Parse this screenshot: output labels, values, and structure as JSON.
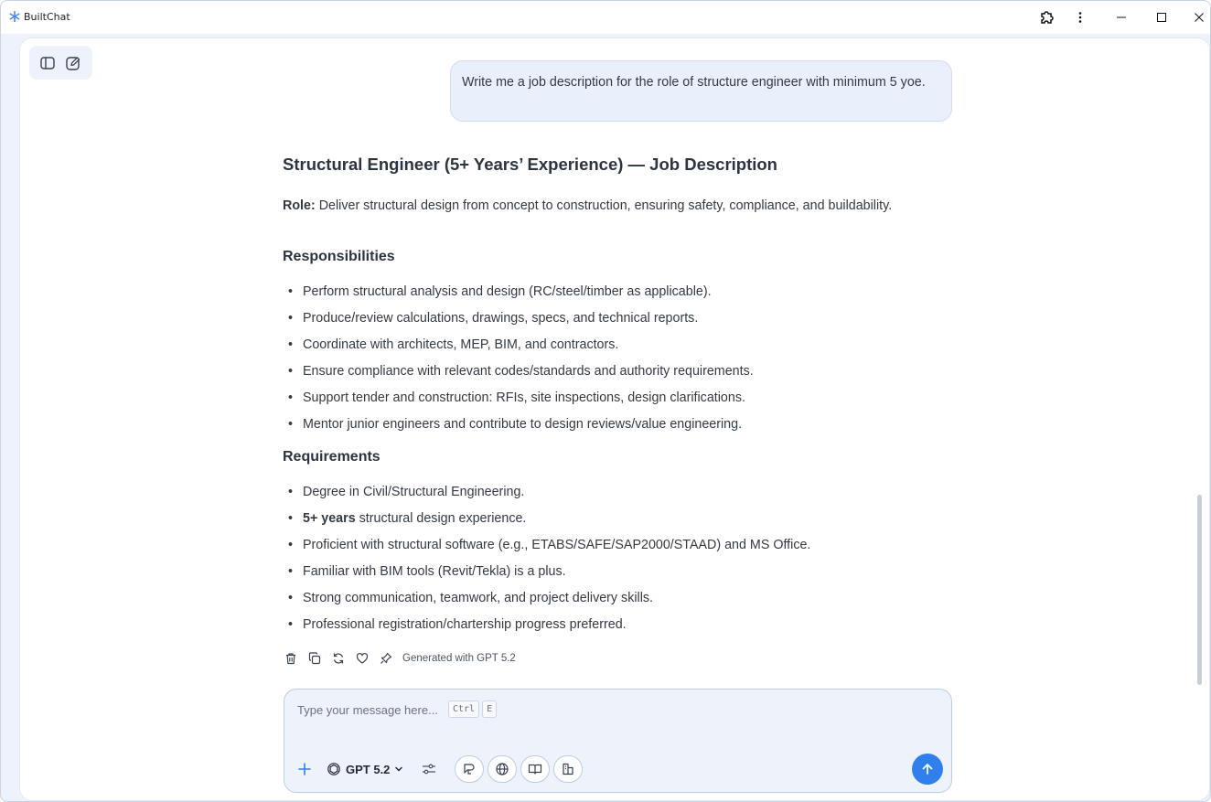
{
  "window": {
    "title": "BuiltChat"
  },
  "titlebar": {
    "icons": [
      "extension-icon",
      "more-vertical-icon",
      "minimize-icon",
      "maximize-icon",
      "close-icon"
    ]
  },
  "toolbar": {
    "icons": [
      "sidebar-toggle-icon",
      "new-chat-icon"
    ]
  },
  "conversation": {
    "user_message": "Write me a job description for the role of structure engineer with minimum 5 yoe.",
    "response": {
      "title": "Structural Engineer (5+ Years’ Experience) — Job Description",
      "role_label": "Role:",
      "role_text": " Deliver structural design from concept to construction, ensuring safety, compliance, and buildability.",
      "responsibilities_heading": "Responsibilities",
      "responsibilities": [
        "Perform structural analysis and design (RC/steel/timber as applicable).",
        "Produce/review calculations, drawings, specs, and technical reports.",
        "Coordinate with architects, MEP, BIM, and contractors.",
        "Ensure compliance with relevant codes/standards and authority requirements.",
        "Support tender and construction: RFIs, site inspections, design clarifications.",
        "Mentor junior engineers and contribute to design reviews/value engineering."
      ],
      "requirements_heading": "Requirements",
      "requirement_1": "Degree in Civil/Structural Engineering.",
      "requirement_2_bold": "5+ years",
      "requirement_2_rest": " structural design experience.",
      "requirement_3": "Proficient with structural software (e.g., ETABS/SAFE/SAP2000/STAAD) and MS Office.",
      "requirement_4": "Familiar with BIM tools (Revit/Tekla) is a plus.",
      "requirement_5": "Strong communication, teamwork, and project delivery skills.",
      "requirement_6": "Professional registration/chartership progress preferred."
    },
    "actions": {
      "icons": [
        "trash-icon",
        "copy-icon",
        "regenerate-icon",
        "heart-icon",
        "pin-icon"
      ],
      "generated_label": "Generated with GPT 5.2"
    }
  },
  "composer": {
    "placeholder": "Type your message here...",
    "shortcut_keys": [
      "Ctrl",
      "E"
    ],
    "model_label": "GPT 5.2",
    "tool_icons": [
      "prompt-icon",
      "web-search-icon",
      "knowledge-book-icon",
      "files-icon"
    ]
  },
  "colors": {
    "accent": "#2f80ed",
    "bubble_bg": "#eaf0fb",
    "window_bg": "#eef3fb"
  }
}
